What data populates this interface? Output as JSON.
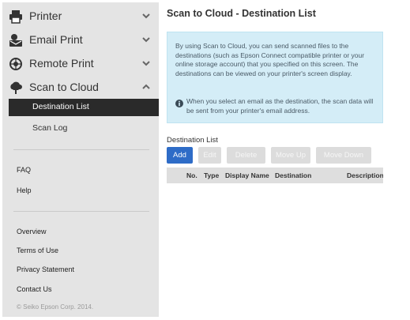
{
  "sidebar": {
    "nav": [
      {
        "label": "Printer",
        "icon": "printer-icon",
        "expanded": false
      },
      {
        "label": "Email Print",
        "icon": "email-print-icon",
        "expanded": false
      },
      {
        "label": "Remote Print",
        "icon": "remote-print-icon",
        "expanded": false
      },
      {
        "label": "Scan to Cloud",
        "icon": "cloud-upload-icon",
        "expanded": true
      }
    ],
    "subitems": [
      {
        "label": "Destination List",
        "active": true
      },
      {
        "label": "Scan Log",
        "active": false
      }
    ],
    "help_links": [
      "FAQ",
      "Help"
    ],
    "footer_links": [
      "Overview",
      "Terms of Use",
      "Privacy Statement",
      "Contact Us"
    ],
    "copyright": "© Seiko Epson Corp. 2014."
  },
  "main": {
    "title": "Scan to Cloud - Destination List",
    "info": {
      "text": "By using Scan to Cloud, you can send scanned files to the destinations (such as Epson Connect compatible printer or your online storage account) that you specified on this screen. The destinations can be viewed on your printer's screen display.",
      "note": "When you select an email as the destination, the scan data will be sent from your printer's email address."
    },
    "list_label": "Destination List",
    "buttons": {
      "add": "Add",
      "edit": "Edit",
      "delete": "Delete",
      "move_up": "Move Up",
      "move_down": "Move Down"
    },
    "table_columns": [
      "No.",
      "Type",
      "Display Name",
      "Destination",
      "Description"
    ]
  },
  "colors": {
    "sidebar_bg": "#e4e4e4",
    "active_item_bg": "#2a2a2a",
    "info_bg": "#d4edf7",
    "primary_button": "#2e6cc7",
    "disabled_button": "#dcdcdc"
  }
}
